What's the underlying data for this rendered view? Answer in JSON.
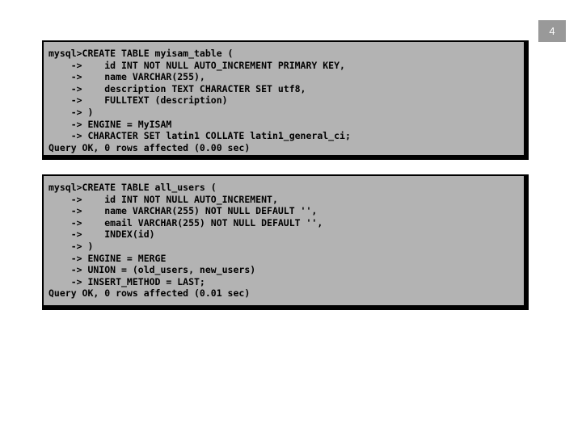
{
  "slide": {
    "page_number": "4",
    "background_color": "#ffffff",
    "console_fill_color": "#b3b3b3",
    "console_border_color": "#000000",
    "badge_color": "#999999",
    "text_color": "#000000"
  },
  "console_blocks": [
    {
      "id": "myisam-table",
      "lines": [
        "mysql>CREATE TABLE myisam_table (",
        "    ->    id INT NOT NULL AUTO_INCREMENT PRIMARY KEY,",
        "    ->    name VARCHAR(255),",
        "    ->    description TEXT CHARACTER SET utf8,",
        "    ->    FULLTEXT (description)",
        "    -> )",
        "    -> ENGINE = MyISAM",
        "    -> CHARACTER SET latin1 COLLATE latin1_general_ci;",
        "Query OK, 0 rows affected (0.00 sec)"
      ],
      "text": "mysql>CREATE TABLE myisam_table (\n    ->    id INT NOT NULL AUTO_INCREMENT PRIMARY KEY,\n    ->    name VARCHAR(255),\n    ->    description TEXT CHARACTER SET utf8,\n    ->    FULLTEXT (description)\n    -> )\n    -> ENGINE = MyISAM\n    -> CHARACTER SET latin1 COLLATE latin1_general_ci;\nQuery OK, 0 rows affected (0.00 sec)",
      "prompt": "mysql>",
      "statement": "CREATE TABLE myisam_table",
      "engine": "MyISAM",
      "result_status": "Query OK",
      "rows_affected": "0",
      "duration": "0.00 sec"
    },
    {
      "id": "all-users-merge-table",
      "lines": [
        "mysql>CREATE TABLE all_users (",
        "    ->    id INT NOT NULL AUTO_INCREMENT,",
        "    ->    name VARCHAR(255) NOT NULL DEFAULT '',",
        "    ->    email VARCHAR(255) NOT NULL DEFAULT '',",
        "    ->    INDEX(id)",
        "    -> )",
        "    -> ENGINE = MERGE",
        "    -> UNION = (old_users, new_users)",
        "    -> INSERT_METHOD = LAST;",
        "Query OK, 0 rows affected (0.01 sec)"
      ],
      "text": "mysql>CREATE TABLE all_users (\n    ->    id INT NOT NULL AUTO_INCREMENT,\n    ->    name VARCHAR(255) NOT NULL DEFAULT '',\n    ->    email VARCHAR(255) NOT NULL DEFAULT '',\n    ->    INDEX(id)\n    -> )\n    -> ENGINE = MERGE\n    -> UNION = (old_users, new_users)\n    -> INSERT_METHOD = LAST;\nQuery OK, 0 rows affected (0.01 sec)",
      "prompt": "mysql>",
      "statement": "CREATE TABLE all_users",
      "engine": "MERGE",
      "union_tables": "(old_users, new_users)",
      "insert_method": "LAST",
      "result_status": "Query OK",
      "rows_affected": "0",
      "duration": "0.01 sec"
    }
  ]
}
